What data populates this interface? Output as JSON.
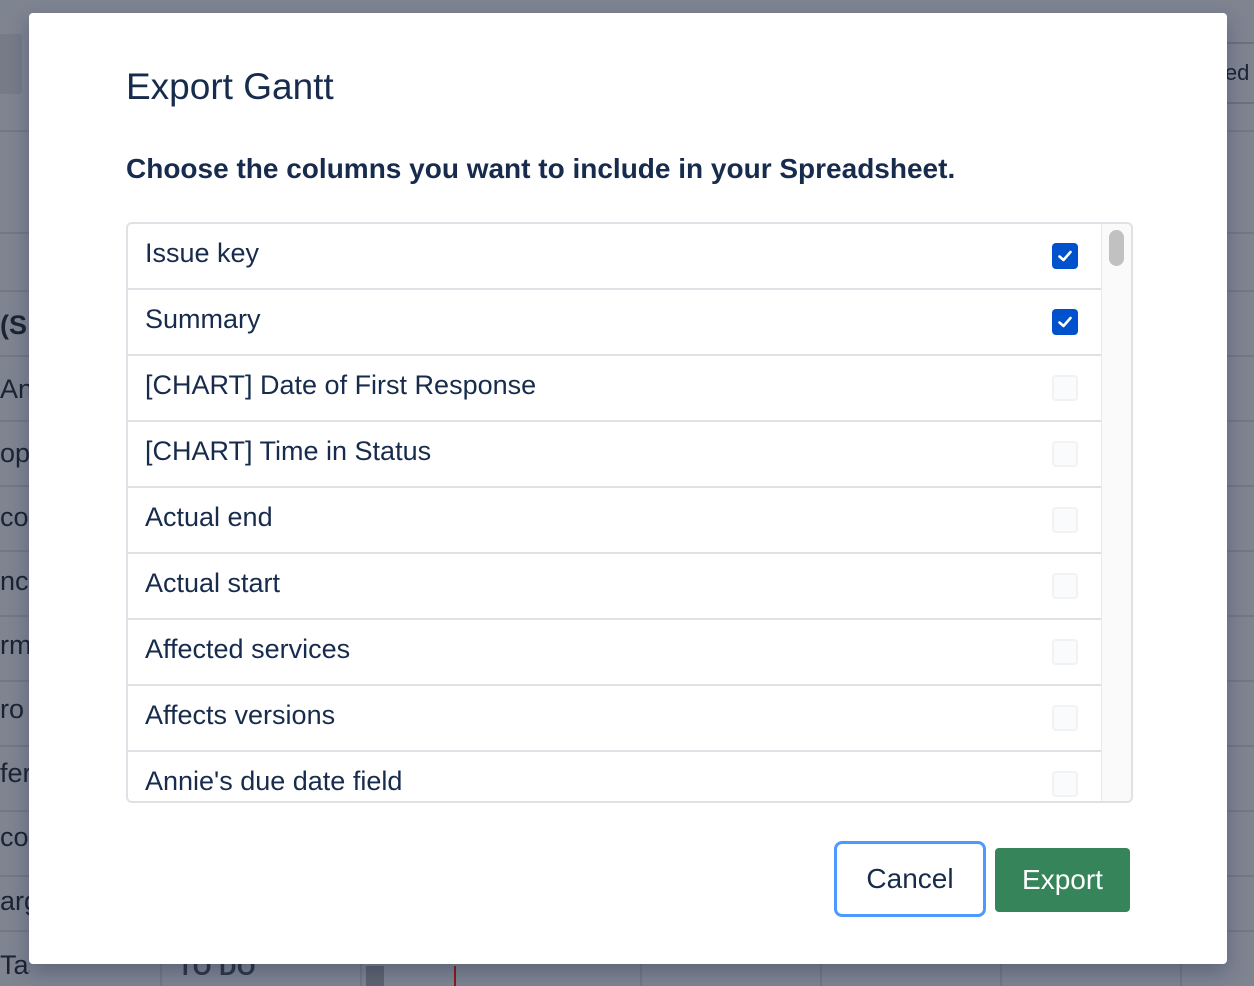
{
  "background": {
    "fragments": [
      {
        "text": "(S",
        "bold": true
      },
      {
        "text": "An",
        "bold": false
      },
      {
        "text": "op",
        "bold": false
      },
      {
        "text": "co",
        "bold": false
      },
      {
        "text": "nc",
        "bold": false
      },
      {
        "text": "rm",
        "bold": false
      },
      {
        "text": "ro",
        "bold": false
      },
      {
        "text": "fer",
        "bold": false
      },
      {
        "text": " co",
        "bold": false
      },
      {
        "text": "arg",
        "bold": false
      },
      {
        "text": "Task",
        "bold": false
      }
    ],
    "right_pill": "led",
    "status_label": "TO DO"
  },
  "modal": {
    "title": "Export Gantt",
    "subtitle": "Choose the columns you want to include in your Spreadsheet.",
    "columns": [
      {
        "label": "Issue key",
        "checked": true
      },
      {
        "label": "Summary",
        "checked": true
      },
      {
        "label": "[CHART] Date of First Response",
        "checked": false
      },
      {
        "label": "[CHART] Time in Status",
        "checked": false
      },
      {
        "label": "Actual end",
        "checked": false
      },
      {
        "label": "Actual start",
        "checked": false
      },
      {
        "label": "Affected services",
        "checked": false
      },
      {
        "label": "Affects versions",
        "checked": false
      },
      {
        "label": "Annie's due date field",
        "checked": false
      }
    ],
    "cancel_label": "Cancel",
    "export_label": "Export"
  },
  "colors": {
    "accent": "#0052cc",
    "export_green": "#36845a",
    "focus_ring": "#4c9aff",
    "text": "#172b4d"
  }
}
